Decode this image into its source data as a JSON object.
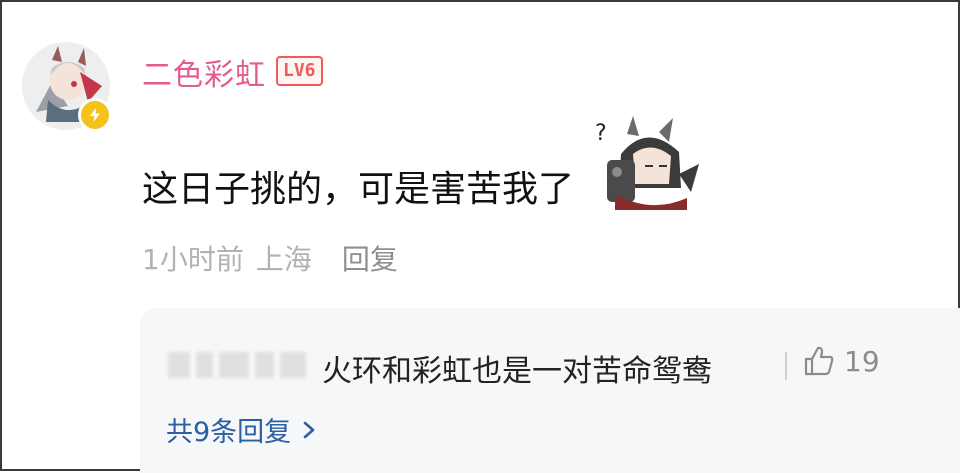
{
  "comment": {
    "username": "二色彩虹",
    "level": "LV6",
    "text": "这日子挑的，可是害苦我了",
    "time": "1小时前",
    "location": "上海",
    "reply_label": "回复"
  },
  "replies": {
    "first_reply_text": "火环和彩虹也是一对苦命鸳鸯",
    "like_count": "19",
    "more_label": "共9条回复"
  },
  "icons": {
    "verified": "lightning-bolt-icon",
    "like": "thumbs-up-icon",
    "more": "chevron-right-icon"
  },
  "colors": {
    "username": "#e35b8f",
    "level_badge": "#ef5a5a",
    "verified_badge": "#f3c21b",
    "link": "#2b5fa3",
    "meta": "#b2b2b2"
  }
}
